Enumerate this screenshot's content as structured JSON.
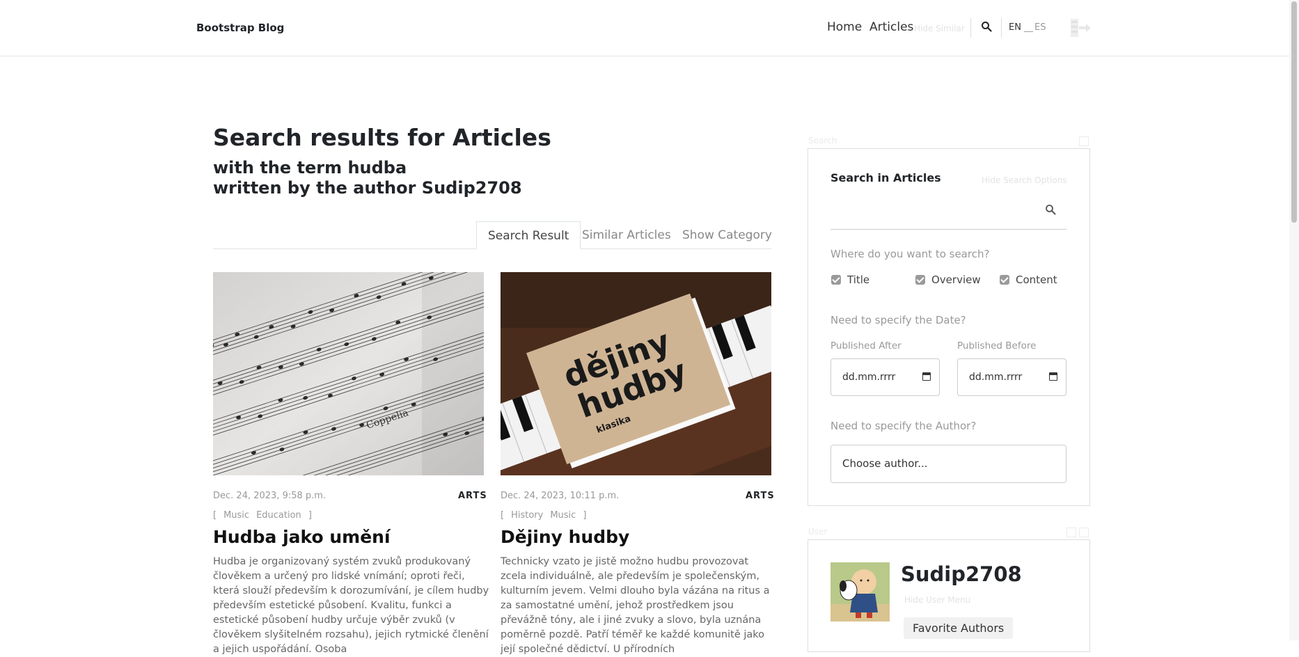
{
  "navbar": {
    "brand": "Bootstrap Blog",
    "links": [
      "Home",
      "Articles"
    ],
    "hide_similar": "Hide Similar",
    "lang_en": "EN",
    "lang_sep": "__",
    "lang_es": "ES"
  },
  "heading": {
    "title": "Search results for Articles",
    "line1": "with the term hudba",
    "line2": "written by the author Sudip2708"
  },
  "tabs": [
    "Search Result",
    "Similar Articles",
    "Show Category"
  ],
  "articles": [
    {
      "date": "Dec. 24, 2023, 9:58 p.m.",
      "category": "ARTS",
      "tags": [
        "Music",
        "Education"
      ],
      "title": "Hudba jako umění",
      "text": "Hudba je organizovaný systém zvuků produkovaný člověkem a určený pro lidské vnímání; oproti řeči, která slouží především k dorozumívání, je cílem hudby především estetické působení. Kvalitu, funkci a estetické působení hudby určuje výběr zvuků (v člověkem slyšitelném rozsahu), jejich rytmické členění a jejich uspořádání. Osoba",
      "image_text": "Coppelia"
    },
    {
      "date": "Dec. 24, 2023, 10:11 p.m.",
      "category": "ARTS",
      "tags": [
        "History",
        "Music"
      ],
      "title": "Dějiny hudby",
      "text": "Technicky vzato je jistě možno hudbu provozovat zcela individuálně, ale především je společenským, kulturním jevem. Velmi dlouho byla vázána na ritus a za samostatné umění, jehož prostředkem jsou převážně tóny, ale i jiné zvuky a slovo, byla uznána poměrně pozdě. Patří téměř ke každé komunitě jako její společné dědictví. U přírodních",
      "image_text_1": "dějiny",
      "image_text_2": "hudby",
      "image_text_3": "klasika"
    }
  ],
  "sidebar": {
    "search_caption": "Search",
    "search_title": "Search in Articles",
    "hide_options": "Hide Search Options",
    "where_question": "Where do you want to search?",
    "checkboxes": [
      "Title",
      "Overview",
      "Content"
    ],
    "date_question": "Need to specify the Date?",
    "published_after": "Published After",
    "published_before": "Published Before",
    "date_placeholder": "dd.mm.rrrr",
    "author_question": "Need to specify the Author?",
    "author_select": "Choose author...",
    "user_caption": "User",
    "username": "Sudip2708",
    "hide_user_menu": "Hide User Menu",
    "favorite_authors": "Favorite Authors"
  },
  "colors": {
    "text": "#212529",
    "muted": "#999999",
    "border": "#dedede",
    "checkbox": "#9a9a9a"
  }
}
